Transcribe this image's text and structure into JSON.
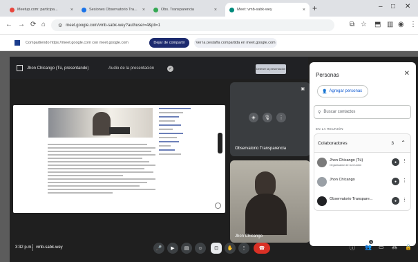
{
  "browser": {
    "tabs": [
      {
        "label": "Meetup.com: participa..."
      },
      {
        "label": "Sesiones Observatorio Tra..."
      },
      {
        "label": "Obs. Transparencia"
      },
      {
        "label": "Meet: vmb-sabk-wey"
      }
    ],
    "url": "meet.google.com/vmb-sabk-wey?authuser=4&pli=1",
    "new_tab": "+",
    "window_controls": [
      "–",
      "□",
      "✕"
    ]
  },
  "sharebar": {
    "message": "Compartiendo https://meet.google.com con meet.google.com",
    "stop_label": "Dejar de compartir",
    "view_label": "Ver la pestaña compartida en meet.google.com"
  },
  "meet": {
    "presenter_title": "Jhon Chicango (Tú, presentando)",
    "audio_label": "Audio de la presentación",
    "stop_presenting": "Detener la presentación",
    "tiles": {
      "observatorio": "Observatorio Transparencia",
      "jhon": "Jhon Chicango"
    }
  },
  "people_panel": {
    "title": "Personas",
    "add_people": "Agregar personas",
    "search_placeholder": "Buscar contactos",
    "section": "EN LA REUNIÓN",
    "group_label": "Colaboradores",
    "group_count": "3",
    "participants": [
      {
        "name": "Jhon Chicango (Tú)",
        "role": "Organizador de la reunión",
        "avatar": "#7a7a7a"
      },
      {
        "name": "Jhon Chicango",
        "role": "",
        "avatar": "#9aa0a6"
      },
      {
        "name": "Observatorio Transpare...",
        "role": "",
        "avatar": "#202124"
      }
    ]
  },
  "controls": {
    "time": "3:32 p.m.",
    "meeting_code": "vmb-sabk-wey",
    "participant_count": "3"
  },
  "colors": {
    "accent": "#1c2a6e",
    "hangup": "#d93025",
    "link": "#0b57d0"
  }
}
